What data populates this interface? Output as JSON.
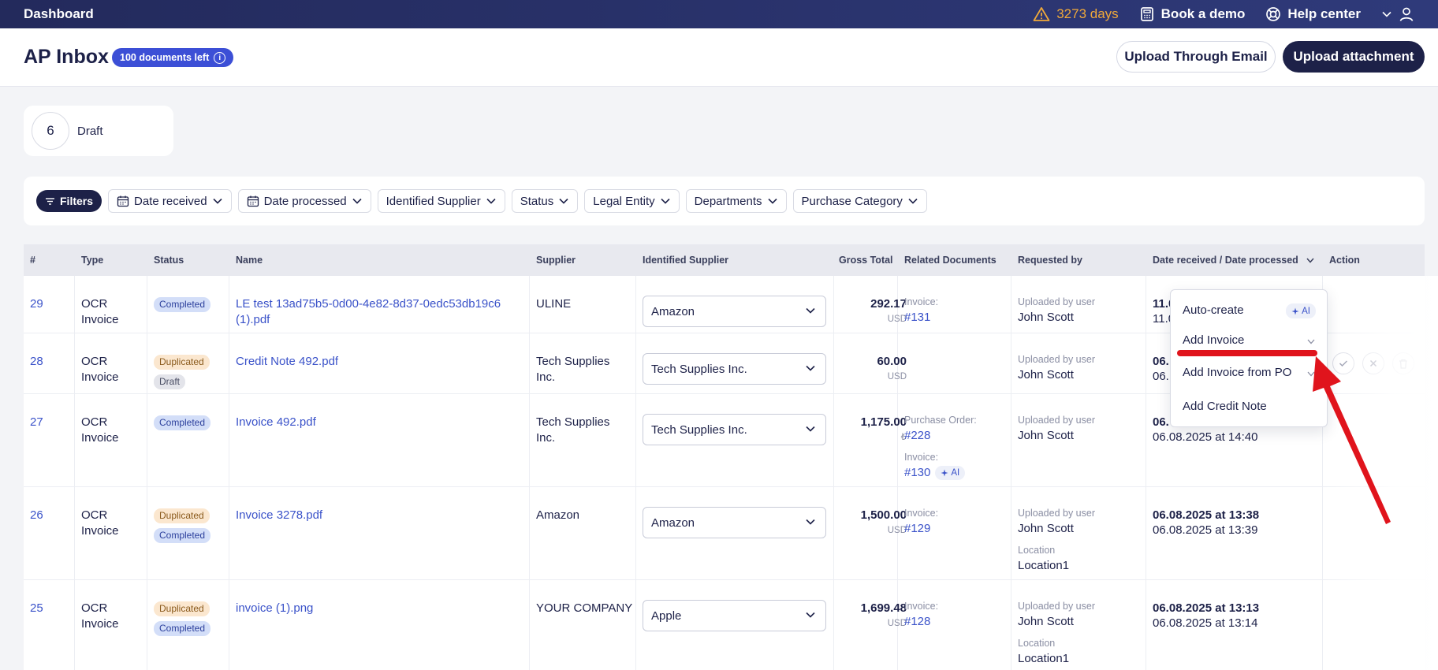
{
  "topbar": {
    "brand": "Dashboard",
    "trial": "3273 days",
    "book_demo": "Book a demo",
    "help": "Help center"
  },
  "header": {
    "title": "AP Inbox",
    "docs_left": "100 documents left",
    "upload_email": "Upload Through Email",
    "upload_attachment": "Upload attachment"
  },
  "summary": {
    "count": "6",
    "label": "Draft"
  },
  "filters": {
    "main": "Filters",
    "items": [
      "Date received",
      "Date processed",
      "Identified Supplier",
      "Status",
      "Legal Entity",
      "Departments",
      "Purchase Category"
    ]
  },
  "table": {
    "columns": [
      "#",
      "Type",
      "Status",
      "Name",
      "Supplier",
      "Identified Supplier",
      "Gross Total",
      "Related Documents",
      "Requested by",
      "Date received / Date processed",
      "Action"
    ],
    "rows": [
      {
        "id": "29",
        "type1": "OCR",
        "type2": "Invoice",
        "status": [
          "Completed"
        ],
        "name1": "LE test 13ad75b5-0d00-4e82-8d37-0edc53db19c6",
        "name2": "(1).pdf",
        "supplier1": "ULINE",
        "supplier2": "",
        "identified": "Amazon",
        "gross": "292.17",
        "currency": "USD",
        "rel_label": "Invoice:",
        "rel_link": "#131",
        "req_label": "Uploaded by user",
        "req_name": "John Scott",
        "date1": "11.0",
        "date2": "11.0"
      },
      {
        "id": "28",
        "type1": "OCR",
        "type2": "Invoice",
        "status": [
          "Duplicated",
          "Draft"
        ],
        "name1": "Credit Note 492.pdf",
        "name2": "",
        "supplier1": "Tech Supplies",
        "supplier2": "Inc.",
        "identified": "Tech Supplies Inc.",
        "gross": "60.00",
        "currency": "USD",
        "rel_label": "",
        "rel_link": "",
        "req_label": "Uploaded by user",
        "req_name": "John Scott",
        "date1": "06.",
        "date2": "06."
      },
      {
        "id": "27",
        "type1": "OCR",
        "type2": "Invoice",
        "status": [
          "Completed"
        ],
        "name1": "Invoice 492.pdf",
        "name2": "",
        "supplier1": "Tech Supplies",
        "supplier2": "Inc.",
        "identified": "Tech Supplies Inc.",
        "gross": "1,175.00",
        "currency": "₺",
        "rel_label": "Purchase Order:",
        "rel_link": "#228",
        "rel_label2": "Invoice:",
        "rel_link2": "#130",
        "rel_ai": "AI",
        "req_label": "Uploaded by user",
        "req_name": "John Scott",
        "date1": "06.",
        "date2": "06.08.2025 at 14:40"
      },
      {
        "id": "26",
        "type1": "OCR",
        "type2": "Invoice",
        "status": [
          "Duplicated",
          "Completed"
        ],
        "name1": "Invoice 3278.pdf",
        "name2": "",
        "supplier1": "Amazon",
        "supplier2": "",
        "identified": "Amazon",
        "gross": "1,500.00",
        "currency": "USD",
        "rel_label": "Invoice:",
        "rel_link": "#129",
        "req_label": "Uploaded by user",
        "req_name": "John Scott",
        "loc_label": "Location",
        "loc_name": "Location1",
        "date1": "06.08.2025 at 13:38",
        "date2": "06.08.2025 at 13:39"
      },
      {
        "id": "25",
        "type1": "OCR",
        "type2": "Invoice",
        "status": [
          "Duplicated",
          "Completed"
        ],
        "name1": "invoice (1).png",
        "name2": "",
        "supplier1": "YOUR COMPANY",
        "supplier2": "",
        "identified": "Apple",
        "gross": "1,699.48",
        "currency": "USD",
        "rel_label": "Invoice:",
        "rel_link": "#128",
        "req_label": "Uploaded by user",
        "req_name": "John Scott",
        "loc_label": "Location",
        "loc_name": "Location1",
        "date1": "06.08.2025 at 13:13",
        "date2": "06.08.2025 at 13:14"
      }
    ]
  },
  "menu": {
    "items": [
      "Auto-create",
      "Add Invoice",
      "Add Invoice from PO",
      "Add Credit Note"
    ],
    "ai_label": "AI"
  },
  "colors": {
    "accent": "#3c4fd6",
    "nav": "#232a5c",
    "annotation": "#e0141c",
    "warning": "#f0a93a"
  }
}
